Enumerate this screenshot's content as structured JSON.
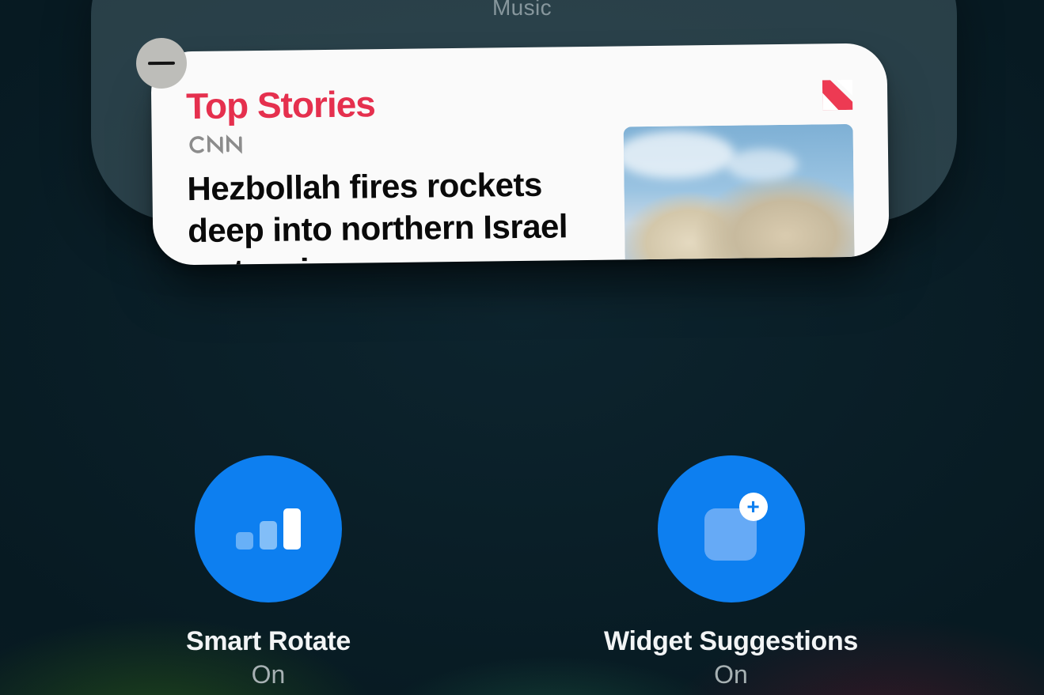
{
  "header": {
    "music_label": "Music"
  },
  "widget": {
    "section_title": "Top Stories",
    "source": "CNN",
    "headline": "Hezbollah fires rockets deep into northern Israel as tensions"
  },
  "options": {
    "smart_rotate": {
      "label": "Smart Rotate",
      "state": "On"
    },
    "widget_suggestions": {
      "label": "Widget Suggestions",
      "state": "On"
    }
  },
  "colors": {
    "accent_blue": "#0d7ff0",
    "title_red": "#e5304e"
  },
  "icons": {
    "remove": "minus-icon",
    "news": "apple-news-icon",
    "bars": "signal-bars-icon",
    "widget_plus": "widget-plus-icon"
  }
}
